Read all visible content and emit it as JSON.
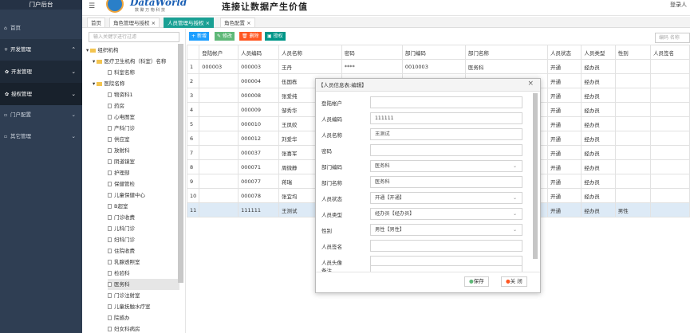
{
  "sidebar": {
    "title": "门户后台",
    "items": [
      {
        "icon": "home-icon",
        "label": "首页"
      },
      {
        "icon": "plus-icon",
        "label": "开发管理"
      },
      {
        "icon": "gear-icon",
        "label": "开发管理"
      },
      {
        "icon": "gear-icon",
        "label": "授权管理"
      },
      {
        "icon": "box-icon",
        "label": "门户配置"
      },
      {
        "icon": "box-icon",
        "label": "其它管理"
      }
    ]
  },
  "header": {
    "brand": "DataWorld",
    "brand_sub": "数 聚 万 物 科 技",
    "slogan": "连接让数据产生价值",
    "login": "登录人"
  },
  "tabs": [
    "首页",
    "角色管理与授权",
    "人员管理与授权",
    "角色配置"
  ],
  "tree": {
    "search_placeholder": "输入关键字进行过滤",
    "root": "组织机构",
    "nodes": [
      "医疗卫生机构（科室）名称",
      "科室名称",
      "医院名称",
      "物资科1",
      "药房",
      "心电图室",
      "产科门诊",
      "供应室",
      "放射科",
      "阴道镜室",
      "护理部",
      "保健管检",
      "儿童保健中心",
      "B超室",
      "门诊收费",
      "儿科门诊",
      "妇科门诊",
      "住院收费",
      "乳腺透照室",
      "检验科",
      "医务科",
      "门诊注射室",
      "儿童抚触水疗室",
      "院感办",
      "妇女科病房"
    ]
  },
  "toolbar": {
    "add": "新增",
    "edit": "修改",
    "delete": "删除",
    "auth": "授权",
    "search_placeholder": "编码 名称"
  },
  "table": {
    "headers": [
      "",
      "登陆帐户",
      "人员编码",
      "人员名称",
      "密码",
      "部门编码",
      "部门名称",
      "人员状态",
      "人员类型",
      "性别",
      "人员签名"
    ],
    "rows": [
      [
        "1",
        "000003",
        "000003",
        "王丹",
        "****",
        "0010003",
        "医务科",
        "开通",
        "经办员",
        "",
        ""
      ],
      [
        "2",
        "",
        "000004",
        "伍国栋",
        "",
        "",
        "",
        "开通",
        "经办员",
        "",
        ""
      ],
      [
        "3",
        "",
        "000008",
        "张爱纯",
        "",
        "",
        "",
        "开通",
        "经办员",
        "",
        ""
      ],
      [
        "4",
        "",
        "000009",
        "邹秀华",
        "",
        "",
        "",
        "开通",
        "经办员",
        "",
        ""
      ],
      [
        "5",
        "",
        "000010",
        "王凤姣",
        "",
        "",
        "",
        "开通",
        "经办员",
        "",
        ""
      ],
      [
        "6",
        "",
        "000012",
        "刘爱华",
        "",
        "",
        "",
        "开通",
        "经办员",
        "",
        ""
      ],
      [
        "7",
        "",
        "000037",
        "张喜军",
        "",
        "",
        "",
        "开通",
        "经办员",
        "",
        ""
      ],
      [
        "8",
        "",
        "000071",
        "周微静",
        "",
        "",
        "",
        "开通",
        "经办员",
        "",
        ""
      ],
      [
        "9",
        "",
        "000077",
        "蒋瑞",
        "",
        "",
        "",
        "开通",
        "经办员",
        "",
        ""
      ],
      [
        "10",
        "",
        "000078",
        "张宜均",
        "",
        "",
        "",
        "开通",
        "经办员",
        "",
        ""
      ],
      [
        "11",
        "",
        "111111",
        "王测试",
        "",
        "",
        "",
        "开通",
        "经办员",
        "男性",
        ""
      ]
    ]
  },
  "modal": {
    "title": "【人员信息表:编辑】",
    "fields": [
      {
        "label": "登陆帐户",
        "value": ""
      },
      {
        "label": "人员编码",
        "value": "111111"
      },
      {
        "label": "人员名称",
        "value": "王测试"
      },
      {
        "label": "密码",
        "value": ""
      },
      {
        "label": "部门编码",
        "value": "医务科"
      },
      {
        "label": "部门名称",
        "value": "医务科"
      },
      {
        "label": "人员状态",
        "value": "开通【开通】"
      },
      {
        "label": "人员类型",
        "value": "经办员【经办员】"
      },
      {
        "label": "性别",
        "value": "男性【男性】"
      },
      {
        "label": "人员签名",
        "value": ""
      },
      {
        "label": "人员头像",
        "value": ""
      },
      {
        "label": "备注",
        "value": ""
      }
    ],
    "save": "保存",
    "close": "关 闭"
  },
  "colors": {
    "sidebar": "#2f3e53",
    "accent": "#1aa094",
    "add": "#1e9fff",
    "edit": "#5fb878",
    "delete": "#ff5722",
    "auth": "#009688"
  }
}
